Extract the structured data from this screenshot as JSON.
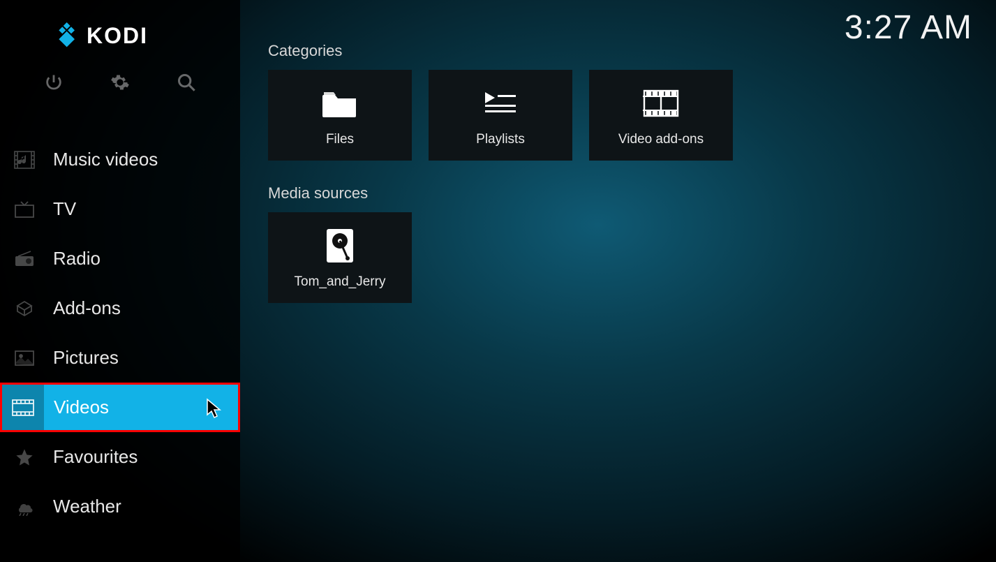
{
  "brand": "KODI",
  "clock": "3:27 AM",
  "sidebar": {
    "items": [
      {
        "label": "Music videos",
        "icon": "music-video-icon",
        "active": false
      },
      {
        "label": "TV",
        "icon": "tv-icon",
        "active": false
      },
      {
        "label": "Radio",
        "icon": "radio-icon",
        "active": false
      },
      {
        "label": "Add-ons",
        "icon": "addons-icon",
        "active": false
      },
      {
        "label": "Pictures",
        "icon": "pictures-icon",
        "active": false
      },
      {
        "label": "Videos",
        "icon": "videos-icon",
        "active": true
      },
      {
        "label": "Favourites",
        "icon": "favourites-icon",
        "active": false
      },
      {
        "label": "Weather",
        "icon": "weather-icon",
        "active": false
      }
    ]
  },
  "sections": {
    "categories": {
      "title": "Categories",
      "items": [
        {
          "label": "Files",
          "icon": "folder-icon"
        },
        {
          "label": "Playlists",
          "icon": "playlist-icon"
        },
        {
          "label": "Video add-ons",
          "icon": "film-icon"
        }
      ]
    },
    "media_sources": {
      "title": "Media sources",
      "items": [
        {
          "label": "Tom_and_Jerry",
          "icon": "harddrive-icon"
        }
      ]
    }
  }
}
